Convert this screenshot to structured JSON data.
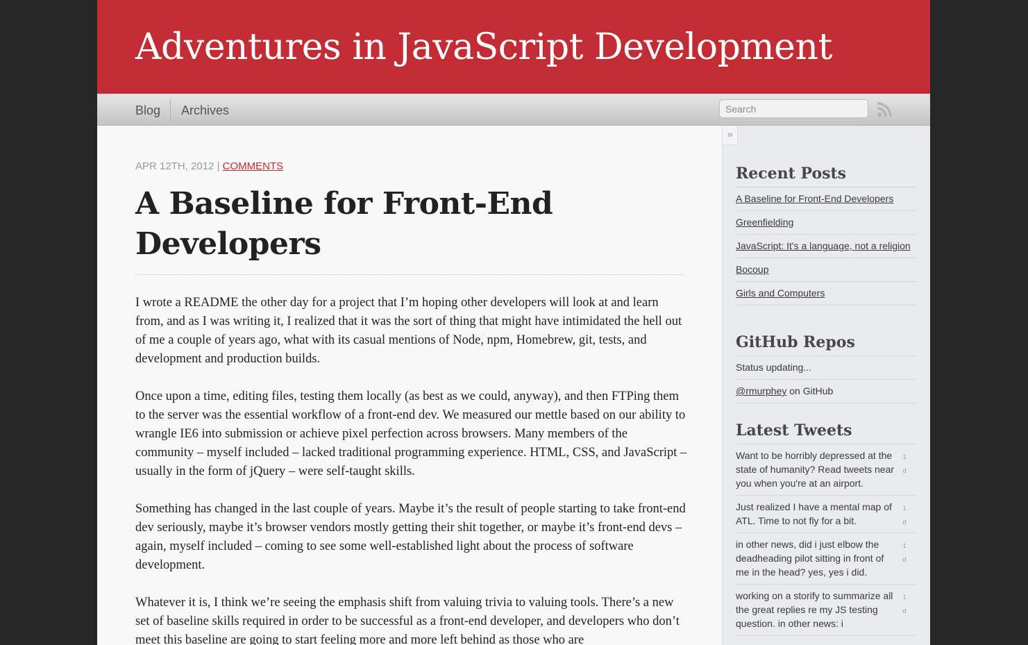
{
  "site": {
    "title": "Adventures in JavaScript Development"
  },
  "nav": {
    "blog_label": "Blog",
    "archives_label": "Archives",
    "search_placeholder": "Search",
    "rss_icon": "rss-icon"
  },
  "post": {
    "date": "APR 12TH, 2012",
    "separator": "|",
    "comments_label": "COMMENTS",
    "title": "A Baseline for Front-End Developers",
    "paragraphs": [
      "I wrote a README the other day for a project that I’m hoping other developers will look at and learn from, and as I was writing it, I realized that it was the sort of thing that might have intimidated the hell out of me a couple of years ago, what with its casual mentions of Node, npm, Homebrew, git, tests, and development and production builds.",
      "Once upon a time, editing files, testing them locally (as best as we could, anyway), and then FTPing them to the server was the essential workflow of a front-end dev. We measured our mettle based on our ability to wrangle IE6 into submission or achieve pixel perfection across browsers. Many members of the community – myself included – lacked traditional programming experience. HTML, CSS, and JavaScript – usually in the form of jQuery – were self-taught skills.",
      "Something has changed in the last couple of years. Maybe it’s the result of people starting to take front-end dev seriously, maybe it’s browser vendors mostly getting their shit together, or maybe it’s front-end devs – again, myself included – coming to see some well-established light about the process of software development.",
      "Whatever it is, I think we’re seeing the emphasis shift from valuing trivia to valuing tools. There’s a new set of baseline skills required in order to be successful as a front-end developer, and developers who don’t meet this baseline are going to start feeling more and more left behind as those who are"
    ]
  },
  "sidebar": {
    "collapse_glyph": "»",
    "recent_posts": {
      "heading": "Recent Posts",
      "items": [
        "A Baseline for Front-End Developers",
        "Greenfielding",
        "JavaScript: It's a language, not a religion",
        "Bocoup",
        "Girls and Computers"
      ]
    },
    "github": {
      "heading": "GitHub Repos",
      "status": "Status updating...",
      "user_link": "@rmurphey",
      "user_suffix": " on GitHub"
    },
    "tweets": {
      "heading": "Latest Tweets",
      "items": [
        {
          "text": "Want to be horribly depressed at the state of humanity? Read tweets near you when you're at an airport.",
          "age_num": "1",
          "age_unit": "d"
        },
        {
          "text": "Just realized I have a mental map of ATL. Time to not fly for a bit.",
          "age_num": "1",
          "age_unit": "d"
        },
        {
          "text": "in other news, did i just elbow the deadheading pilot sitting in front of me in the head? yes, yes i did.",
          "age_num": "1",
          "age_unit": "d"
        },
        {
          "text": "working on a storify to summarize all the great replies re my JS testing question. in other news: i",
          "age_num": "1",
          "age_unit": "d"
        }
      ]
    }
  },
  "colors": {
    "brand_red": "#c22d35",
    "outer_bg": "#262626",
    "sidebar_bg": "#eaebee"
  }
}
